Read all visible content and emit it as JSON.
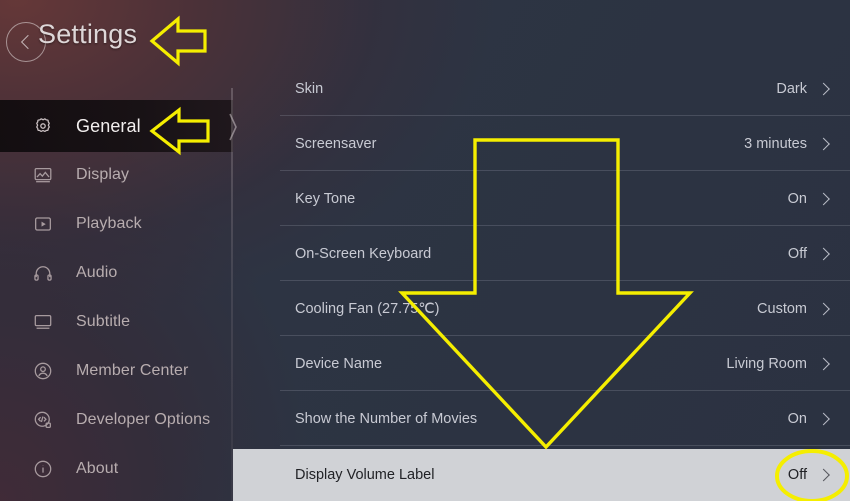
{
  "header": {
    "title": "Settings",
    "back_icon": "chevron-left-circle-icon"
  },
  "sidebar": {
    "items": [
      {
        "label": "General",
        "icon": "gear-icon",
        "selected": true
      },
      {
        "label": "Display",
        "icon": "image-icon",
        "selected": false
      },
      {
        "label": "Playback",
        "icon": "play-box-icon",
        "selected": false
      },
      {
        "label": "Audio",
        "icon": "headphones-icon",
        "selected": false
      },
      {
        "label": "Subtitle",
        "icon": "monitor-icon",
        "selected": false
      },
      {
        "label": "Member Center",
        "icon": "user-circle-icon",
        "selected": false
      },
      {
        "label": "Developer Options",
        "icon": "code-circle-icon",
        "selected": false
      },
      {
        "label": "About",
        "icon": "info-circle-icon",
        "selected": false
      }
    ]
  },
  "list": {
    "rows": [
      {
        "label": "Skin",
        "value": "Dark",
        "highlight": false
      },
      {
        "label": "Screensaver",
        "value": "3 minutes",
        "highlight": false
      },
      {
        "label": "Key Tone",
        "value": "On",
        "highlight": false
      },
      {
        "label": "On-Screen Keyboard",
        "value": "Off",
        "highlight": false
      },
      {
        "label": "Cooling Fan (27.75℃)",
        "value": "Custom",
        "highlight": false
      },
      {
        "label": "Device Name",
        "value": "Living Room",
        "highlight": false
      },
      {
        "label": "Show the Number of Movies",
        "value": "On",
        "highlight": false
      },
      {
        "label": "Display Volume Label",
        "value": "Off",
        "highlight": true
      }
    ]
  },
  "annotations": {
    "color": "#f5ee00",
    "items": [
      {
        "name": "arrow-pointing-to-settings-title",
        "shape": "arrow-left"
      },
      {
        "name": "arrow-pointing-to-general-tab",
        "shape": "arrow-left"
      },
      {
        "name": "arrow-pointing-to-display-volume-label",
        "shape": "arrow-down"
      },
      {
        "name": "ellipse-highlighting-off-value",
        "shape": "ellipse"
      }
    ]
  },
  "colors": {
    "accent_yellow": "#f5ee00",
    "list_bg": "#2d3443",
    "sidebar_warm": "#56302f",
    "highlight_row_bg": "#d0d2d6",
    "text_primary": "#c8cad3",
    "text_sidebar": "#b8adaf"
  }
}
